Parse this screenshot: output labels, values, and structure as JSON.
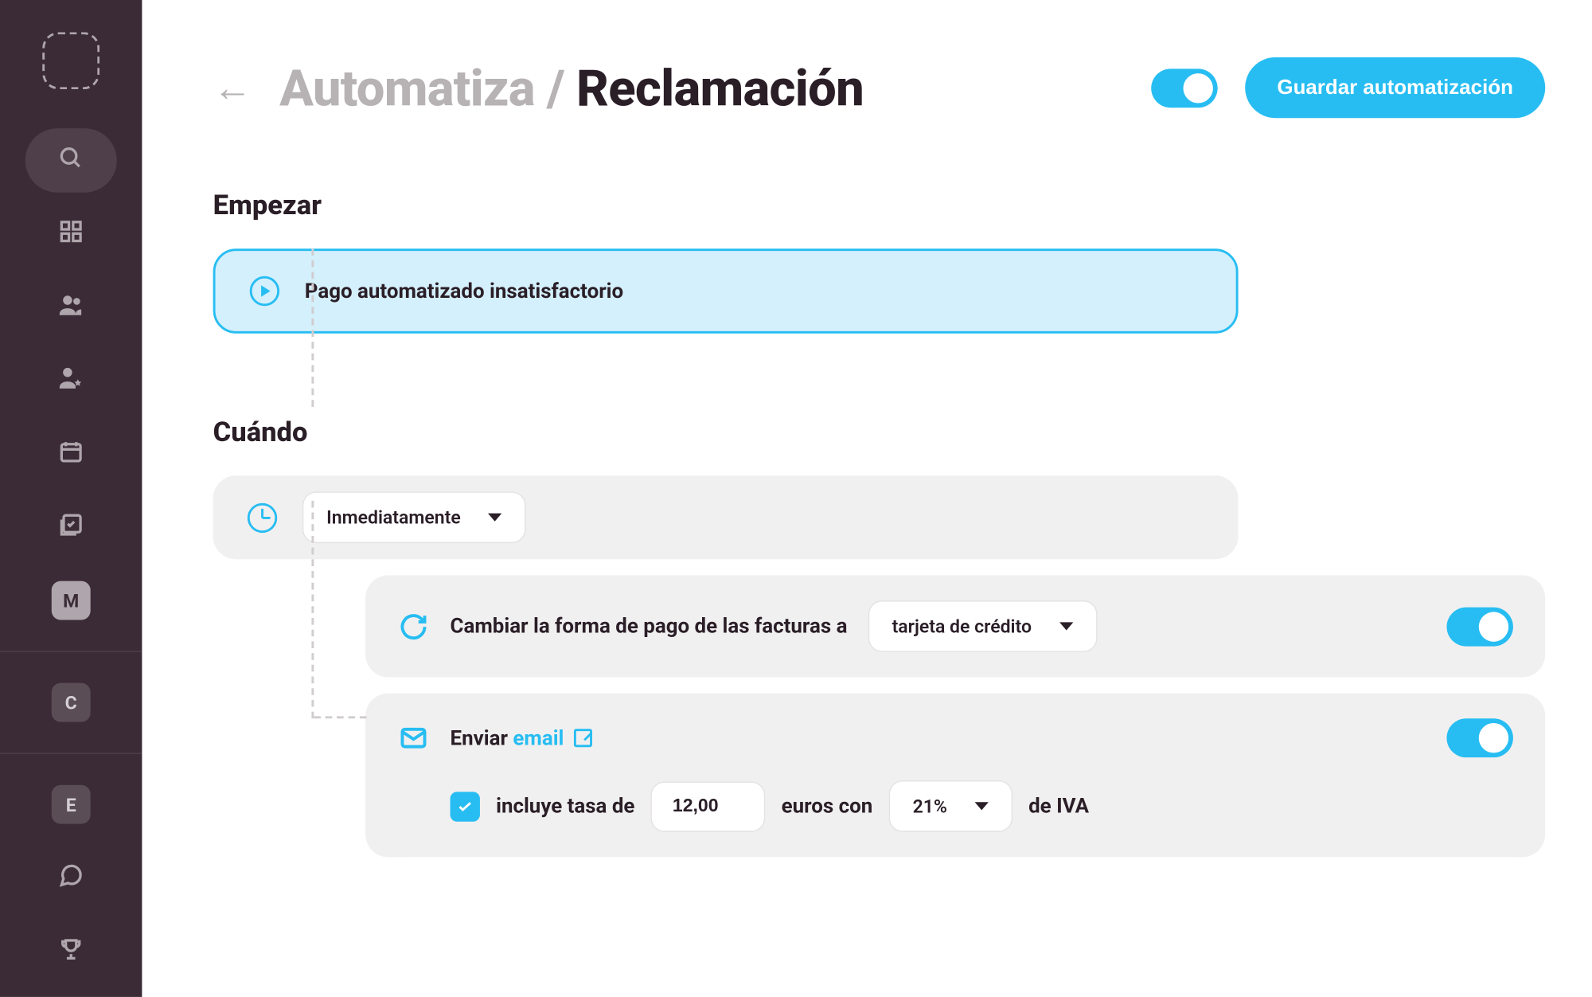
{
  "header": {
    "breadcrumb_parent": "Automatiza",
    "breadcrumb_separator": " / ",
    "breadcrumb_current": "Reclamación",
    "save_label": "Guardar automatización",
    "automation_enabled": true
  },
  "sections": {
    "start_title": "Empezar",
    "when_title": "Cuándo"
  },
  "trigger": {
    "label": "Pago automatizado insatisfactorio"
  },
  "when": {
    "timing_selected": "Inmediatamente"
  },
  "actions": {
    "change_payment": {
      "label": "Cambiar la forma de pago de las facturas a",
      "method_selected": "tarjeta de crédito",
      "enabled": true
    },
    "send_email": {
      "prefix": "Enviar",
      "link_label": "email",
      "enabled": true,
      "fee": {
        "checked": true,
        "prefix": "incluye tasa de",
        "amount": "12,00",
        "mid": "euros con",
        "vat_selected": "21%",
        "suffix": "de IVA"
      }
    }
  },
  "sidebar": {
    "badges": {
      "m": "M",
      "c": "C",
      "e": "E"
    }
  }
}
